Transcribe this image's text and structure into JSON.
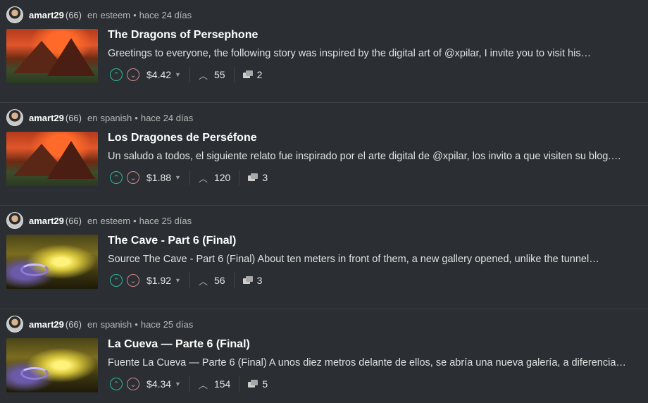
{
  "posts": [
    {
      "author": "amart29",
      "reputation": "(66)",
      "community_prefix": "en",
      "community": "esteem",
      "time": "hace 24 días",
      "title": "The Dragons of Persephone",
      "summary": "Greetings to everyone, the following story was inspired by the digital art of @xpilar, I invite you to visit his…",
      "payout": "$4.42",
      "votes": "55",
      "comments": "2",
      "thumbnail": "dragon-landscape"
    },
    {
      "author": "amart29",
      "reputation": "(66)",
      "community_prefix": "en",
      "community": "spanish",
      "time": "hace 24 días",
      "title": "Los Dragones de Perséfone",
      "summary": "Un saludo a todos, el siguiente relato fue inspirado por el arte digital de @xpilar, los invito a que visiten su blog.…",
      "payout": "$1.88",
      "votes": "120",
      "comments": "3",
      "thumbnail": "dragon-landscape"
    },
    {
      "author": "amart29",
      "reputation": "(66)",
      "community_prefix": "en",
      "community": "esteem",
      "time": "hace 25 días",
      "title": "The Cave - Part 6 (Final)",
      "summary": "Source The Cave - Part 6 (Final) About ten meters in front of them, a new gallery opened, unlike the tunnel…",
      "payout": "$1.92",
      "votes": "56",
      "comments": "3",
      "thumbnail": "cave-scene"
    },
    {
      "author": "amart29",
      "reputation": "(66)",
      "community_prefix": "en",
      "community": "spanish",
      "time": "hace 25 días",
      "title": "La Cueva — Parte 6 (Final)",
      "summary": "Fuente La Cueva — Parte 6 (Final) A unos diez metros delante de ellos, se abría una nueva galería, a diferencia…",
      "payout": "$4.34",
      "votes": "154",
      "comments": "5",
      "thumbnail": "cave-scene"
    }
  ],
  "icons": {
    "upvote": "upvote-icon",
    "downvote": "downvote-icon",
    "payout_dropdown": "caret-down-icon",
    "votes": "chevron-up-icon",
    "comments": "comments-icon"
  },
  "colors": {
    "background": "#2b2f33",
    "upvote": "#2fb89b",
    "downvote": "#cc8888",
    "divider": "#3a3f44"
  }
}
